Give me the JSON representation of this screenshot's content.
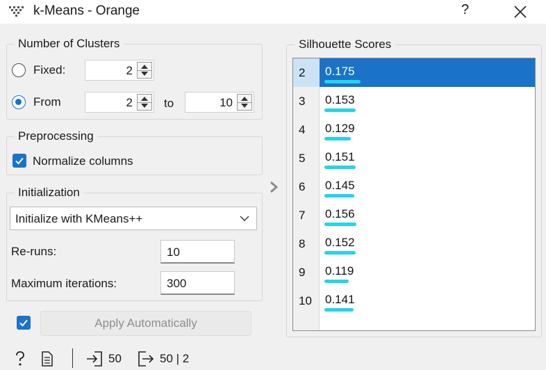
{
  "window": {
    "title": "k-Means - Orange",
    "help_label": "?",
    "icons": {
      "app": "orange-widget-icon",
      "close": "close-icon"
    }
  },
  "clusters": {
    "legend": "Number of Clusters",
    "fixed_label": "Fixed:",
    "fixed_value": "2",
    "from_label": "From",
    "from_value": "2",
    "to_label": "to",
    "to_value": "10",
    "selected": "from"
  },
  "preprocessing": {
    "legend": "Preprocessing",
    "normalize_label": "Normalize columns",
    "normalize_checked": true
  },
  "initialization": {
    "legend": "Initialization",
    "method": "Initialize with KMeans++",
    "reruns_label": "Re-runs:",
    "reruns_value": "10",
    "maxiter_label": "Maximum iterations:",
    "maxiter_value": "300"
  },
  "apply": {
    "checked": true,
    "label": "Apply Automatically"
  },
  "silhouette": {
    "legend": "Silhouette Scores",
    "selected_row": 0,
    "rows": [
      {
        "k": "2",
        "score": "0.175"
      },
      {
        "k": "3",
        "score": "0.153"
      },
      {
        "k": "4",
        "score": "0.129"
      },
      {
        "k": "5",
        "score": "0.151"
      },
      {
        "k": "6",
        "score": "0.145"
      },
      {
        "k": "7",
        "score": "0.156"
      },
      {
        "k": "8",
        "score": "0.152"
      },
      {
        "k": "9",
        "score": "0.119"
      },
      {
        "k": "10",
        "score": "0.141"
      }
    ],
    "bar_color": "#21d6e8",
    "selection_color": "#1a73c9"
  },
  "footer": {
    "input_count": "50",
    "output_count": "50 | 2",
    "icons": [
      "help-icon",
      "report-icon",
      "input-icon",
      "output-icon"
    ]
  }
}
